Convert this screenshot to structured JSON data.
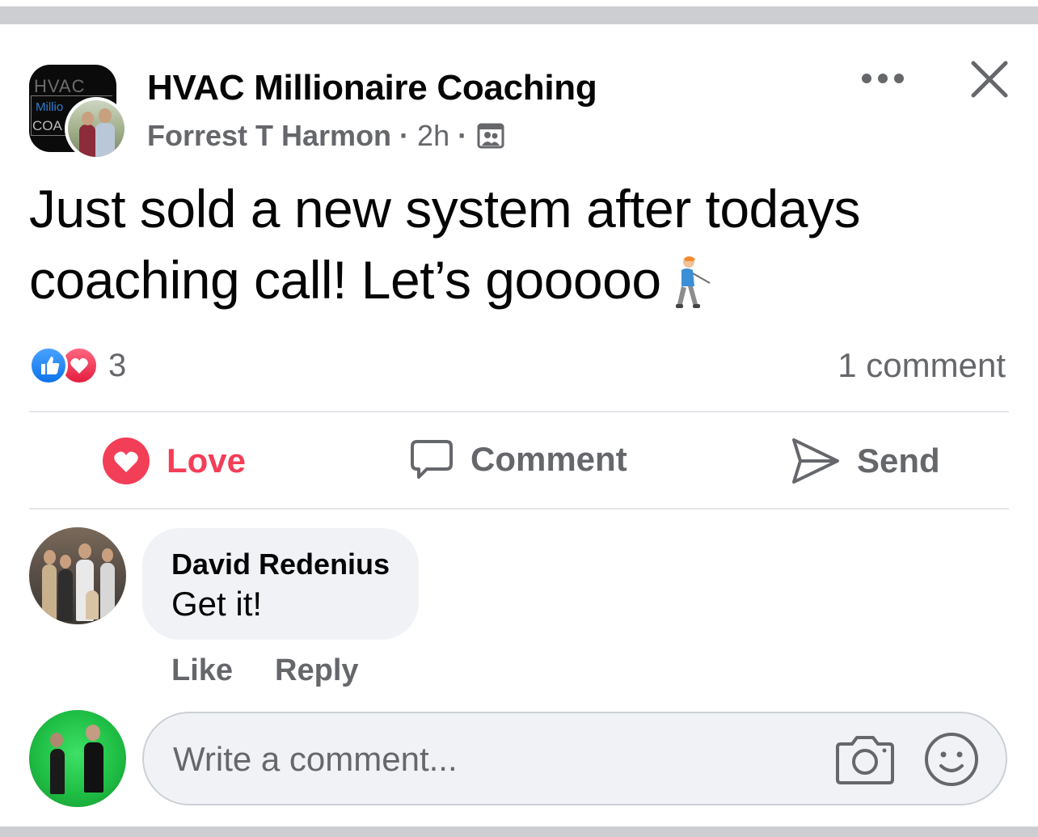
{
  "post": {
    "group_name": "HVAC Millionaire Coaching",
    "author": "Forrest T Harmon",
    "separator": "·",
    "time": "2h",
    "text": "Just sold a new system after todays coaching call! Let’s gooooo",
    "emoji": "person-golfing",
    "group_logo": {
      "line1": "HVAC",
      "line2": "Millio",
      "line3": "COA"
    }
  },
  "stats": {
    "reaction_count": "3",
    "comment_count": "1 comment",
    "reactions": [
      "like",
      "love"
    ]
  },
  "actions": {
    "love_label": "Love",
    "comment_label": "Comment",
    "send_label": "Send"
  },
  "comments": [
    {
      "author": "David Redenius",
      "text": "Get it!",
      "like_label": "Like",
      "reply_label": "Reply"
    }
  ],
  "composer": {
    "placeholder": "Write a comment..."
  },
  "colors": {
    "love": "#f33e58",
    "like": "#0b73ea",
    "secondary_text": "#65676b",
    "bubble": "#f0f2f5"
  }
}
